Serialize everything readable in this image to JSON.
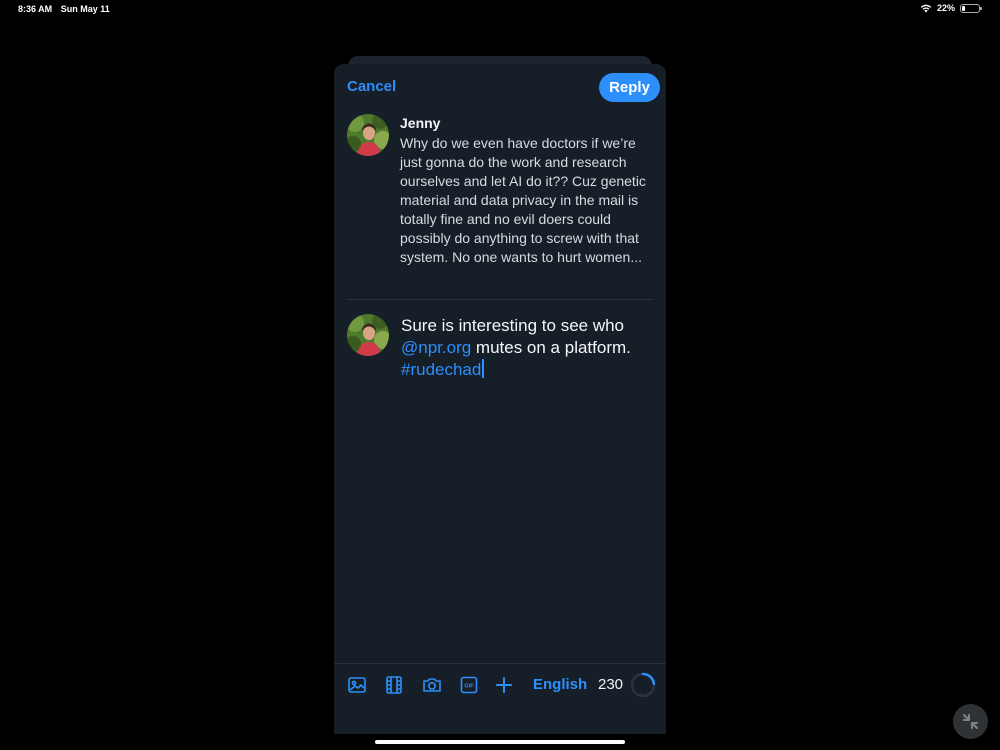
{
  "status_bar": {
    "time": "8:36 AM",
    "date": "Sun May 11",
    "battery": "22%"
  },
  "header": {
    "cancel_label": "Cancel",
    "reply_label": "Reply"
  },
  "parent_post": {
    "author": "Jenny",
    "text": "Why do we even have doctors if we’re just gonna do the work and research ourselves and let AI do it?? Cuz genetic material and data privacy in the mail is totally fine and no evil doers could possibly do anything to screw with that system. No one wants to hurt women..."
  },
  "compose": {
    "text_before": "Sure is interesting to see who ",
    "mention": "@npr.org",
    "text_after": " mutes on a platform. ",
    "hashtag": "#rudechad"
  },
  "toolbar": {
    "icons": [
      "image-icon",
      "video-icon",
      "camera-icon",
      "gif-icon",
      "plus-icon"
    ],
    "language": "English",
    "remaining_chars": "230",
    "char_progress": 0.23
  },
  "colors": {
    "accent": "#2c8ffb",
    "sheet_bg": "#161e27",
    "page_bg": "#000000"
  }
}
